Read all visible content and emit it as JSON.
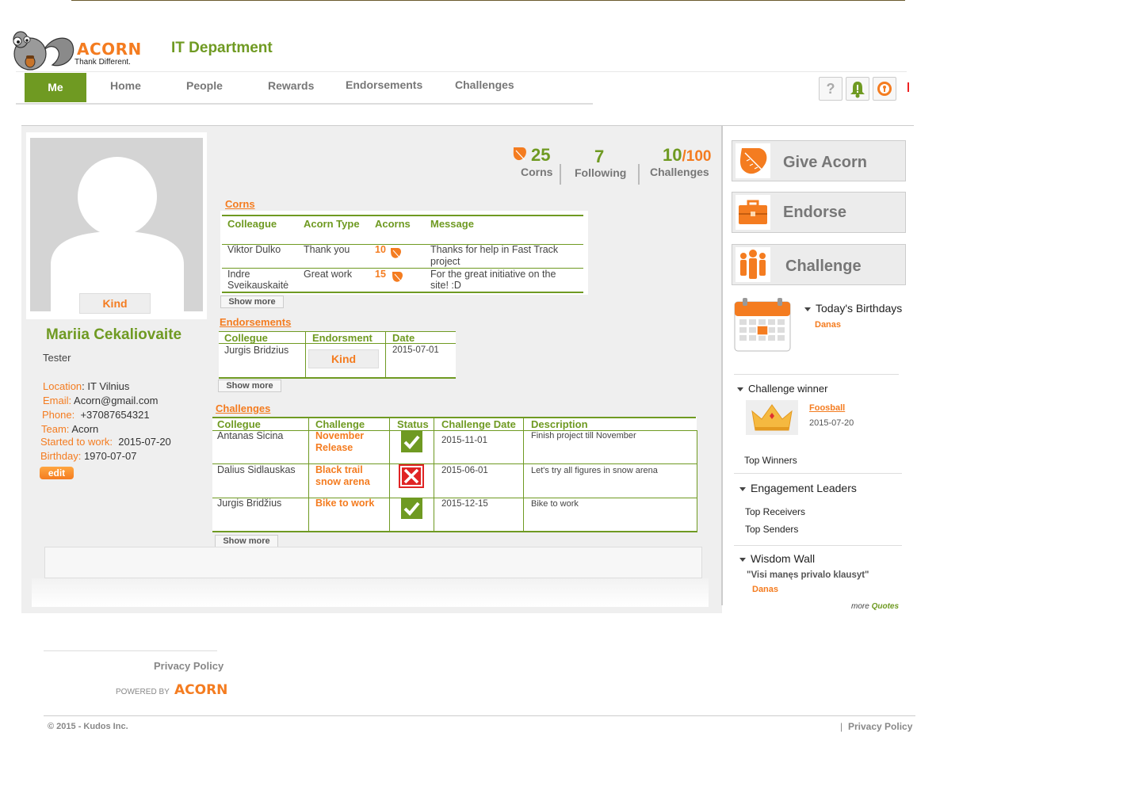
{
  "header": {
    "logo_text": "ACORN",
    "logo_tagline": "Thank Different.",
    "department": "IT Department",
    "nav": [
      "Me",
      "Home",
      "People",
      "Rewards",
      "Endorsements",
      "Challenges"
    ],
    "icons": [
      "help-icon",
      "notification-bell-icon",
      "key-icon"
    ],
    "help_glyph": "?"
  },
  "profile": {
    "badge": "Kind",
    "name": "Mariia Cekaliovaite",
    "role": "Tester",
    "location_label": "Location",
    "location": "IT Vilnius",
    "email_label": "Email:",
    "email": "Acorn@gmail.com",
    "phone_label": "Phone:",
    "phone": "+37087654321",
    "team_label": "Team:",
    "team": "Acorn",
    "started_label": "Started to work:",
    "started": "2015-07-20",
    "birthday_label": "Birthday:",
    "birthday": "1970-07-07",
    "edit": "edit"
  },
  "stats": {
    "corns_value": "25",
    "corns_label": "Corns",
    "following_value": "7",
    "following_label": "Following",
    "challenges_value": "10",
    "challenges_total": "/100",
    "challenges_label": "Challenges"
  },
  "corns": {
    "title": "Corns",
    "headers": [
      "Colleague",
      "Acorn Type",
      "Acorns",
      "Message"
    ],
    "rows": [
      {
        "colleague": "Viktor Dulko",
        "type": "Thank you",
        "acorns": "10",
        "message1": "Thanks for help in Fast Track",
        "message2": "project"
      },
      {
        "colleague": "Indre Sveikauskaitė",
        "type": "Great work",
        "acorns": "15",
        "message1": "For the great initiative on the",
        "message2": "site! :D"
      }
    ],
    "show_more": "Show more"
  },
  "endorsements": {
    "title": "Endorsements",
    "headers": [
      "Collegue",
      "Endorsment",
      "Date"
    ],
    "rows": [
      {
        "colleague": "Jurgis Bridzius",
        "endorsement": "Kind",
        "date": "2015-07-01"
      }
    ],
    "show_more": "Show more"
  },
  "challenges": {
    "title": "Challenges",
    "headers": [
      "Collegue",
      "Challenge",
      "Status",
      "Challenge Date",
      "Description"
    ],
    "rows": [
      {
        "colleague": "Antanas Sicina",
        "challenge": "November Release",
        "status": "done",
        "date": "2015-11-01",
        "description": "Finish project till November"
      },
      {
        "colleague": "Dalius Sidlauskas",
        "challenge": "Black trail snow arena",
        "status": "failed",
        "date": "2015-06-01",
        "description": "Let's try all figures in snow arena"
      },
      {
        "colleague": "Jurgis Bridžius",
        "challenge": "Bike to work",
        "status": "done",
        "date": "2015-12-15",
        "description": "Bike to work"
      }
    ],
    "show_more": "Show more"
  },
  "sidebar": {
    "give_acorn": "Give Acorn",
    "endorse": "Endorse",
    "challenge": "Challenge",
    "birthdays_title": "Today's Birthdays",
    "birthday_person": "Danas",
    "challenge_winner_title": "Challenge winner",
    "winner_challenge": "Foosball",
    "winner_date": "2015-07-20",
    "top_winners": "Top Winners",
    "engagement_title": "Engagement Leaders",
    "top_receivers": "Top Receivers",
    "top_senders": "Top Senders",
    "wisdom_title": "Wisdom Wall",
    "quote": "\"Visi manęs privalo klausyt\"",
    "quote_author": "Danas",
    "more": "more",
    "quotes_link": "Quotes"
  },
  "footer": {
    "privacy": "Privacy Policy",
    "powered_by": "POWERED BY",
    "powered_brand": "ACORN",
    "copyright": "© 2015 - Kudos Inc.",
    "separator": "|",
    "privacy2": "Privacy Policy"
  },
  "colors": {
    "brand_orange": "#f47c20",
    "brand_green": "#6f9a22"
  }
}
